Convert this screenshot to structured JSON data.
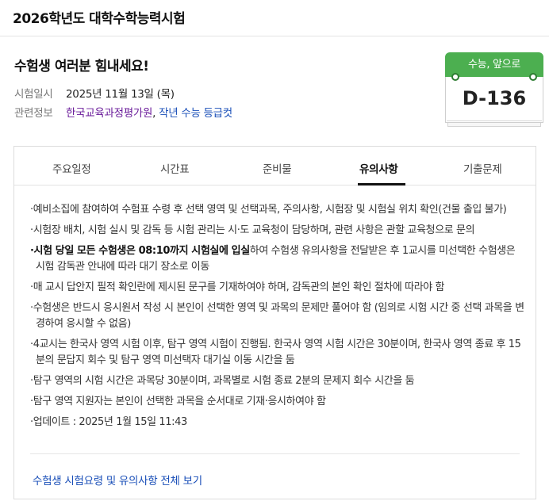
{
  "header": {
    "title": "2026학년도 대학수학능력시험"
  },
  "summary": {
    "cheer": "수험생 여러분 힘내세요!",
    "exam_date_label": "시험일시",
    "exam_date_value": "2025년 11월 13일 (목)",
    "related_label": "관련정보",
    "related_link1": "한국교육과정평가원",
    "related_sep": ",",
    "related_link2": "작년 수능 등급컷"
  },
  "dday": {
    "caption": "수능, 앞으로",
    "value": "D-136"
  },
  "tabs": [
    {
      "label": "주요일정",
      "active": false
    },
    {
      "label": "시간표",
      "active": false
    },
    {
      "label": "준비물",
      "active": false
    },
    {
      "label": "유의사항",
      "active": true
    },
    {
      "label": "기출문제",
      "active": false
    }
  ],
  "notes": [
    {
      "text": "·예비소집에 참여하여 수험표 수령 후 선택 영역 및 선택과목, 주의사항, 시험장 및 시험실 위치 확인(건물 출입 불가)"
    },
    {
      "text": "·시험장 배치, 시험 실시 및 감독 등 시험 관리는 시·도 교육청이 담당하며, 관련 사항은 관할 교육청으로 문의"
    },
    {
      "bold": "·시험 당일 모든 수험생은 08:10까지 시험실에 입실",
      "text": "하여 수험생 유의사항을 전달받은 후 1교시를 미선택한 수험생은 시험 감독관 안내에 따라 대기 장소로 이동"
    },
    {
      "text": "·매 교시 답안지 필적 확인란에 제시된 문구를 기재하여야 하며, 감독관의 본인 확인 절차에 따라야 함"
    },
    {
      "text": "·수험생은 반드시 응시원서 작성 시 본인이 선택한 영역 및 과목의 문제만 풀어야 함 (임의로 시험 시간 중 선택 과목을 변경하여 응시할 수 없음)"
    },
    {
      "text": "·4교시는 한국사 영역 시험 이후, 탐구 영역 시험이 진행됨. 한국사 영역 시험 시간은 30분이며, 한국사 영역 종료 후 15분의 문답지 회수 및 탐구 영역 미선택자 대기실 이동 시간을 둠"
    },
    {
      "text": "·탐구 영역의 시험 시간은 과목당 30분이며, 과목별로 시험 종료 2분의 문제지 회수 시간을 둠"
    },
    {
      "text": "·탐구 영역 지원자는 본인이 선택한 과목을 순서대로 기재·응시하여야 함"
    },
    {
      "text": "·업데이트 : 2025년 1월 15일 11:43"
    }
  ],
  "more_link": "수험생 시험요령 및 유의사항 전체 보기",
  "colors": {
    "accent_green": "#4caf50",
    "link_blue": "#1a4fb8",
    "link_purple": "#6a1b9a"
  }
}
